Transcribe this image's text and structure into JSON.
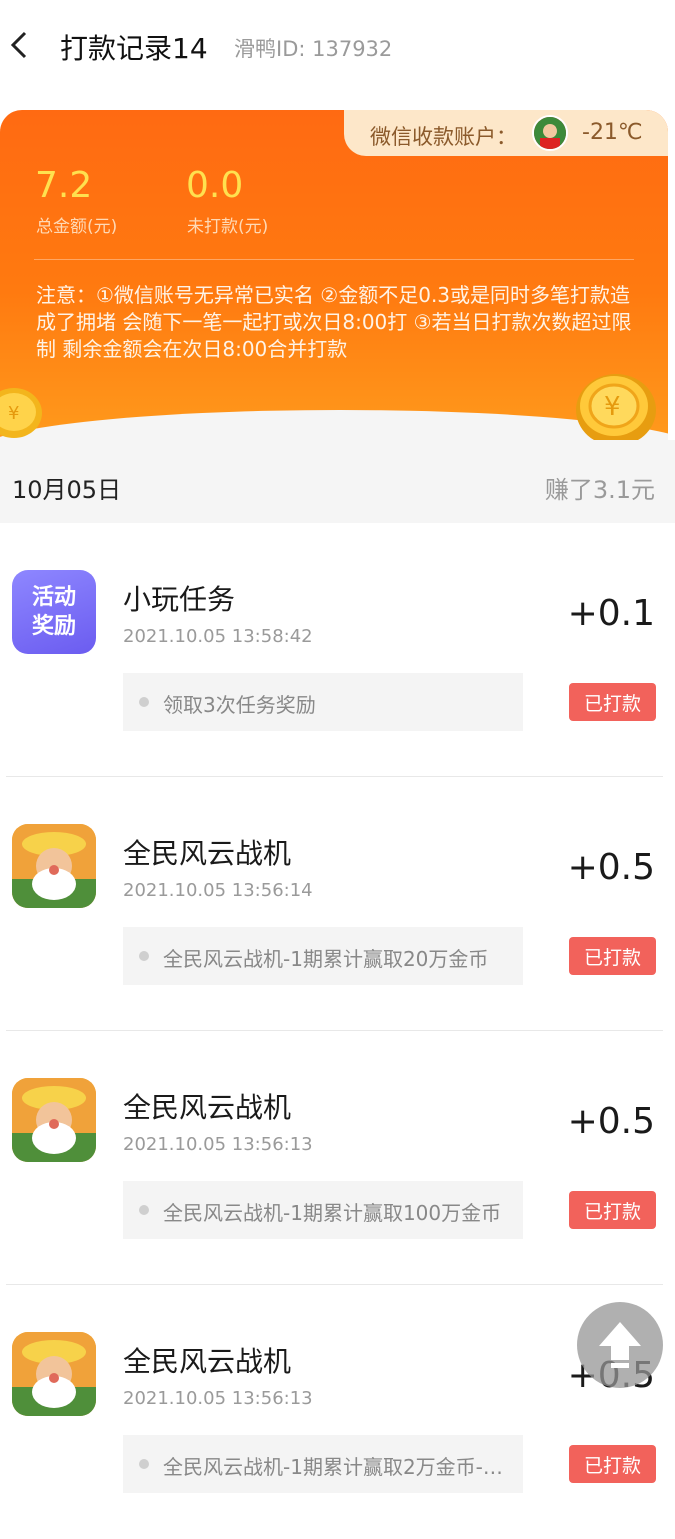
{
  "header": {
    "title": "打款记录14",
    "subtitle": "滑鸭ID: 137932"
  },
  "account": {
    "label": "微信收款账户：",
    "temperature": "-21℃"
  },
  "stats": [
    {
      "value": "7.2",
      "label": "总金额(元)"
    },
    {
      "value": "0.0",
      "label": "未打款(元)"
    }
  ],
  "notice": "注意：①微信账号无异常已实名 ②金额不足0.3或是同时多笔打款造成了拥堵 会随下一笔一起打或次日8:00打 ③若当日打款次数超过限制 剩余金额会在次日8:00合并打款",
  "day": {
    "date": "10月05日",
    "earned": "赚了3.1元"
  },
  "records": [
    {
      "icon_type": "activity",
      "icon_text1": "活动",
      "icon_text2": "奖励",
      "name": "小玩任务",
      "time": "2021.10.05 13:58:42",
      "amount": "+0.1",
      "desc": "领取3次任务奖励",
      "status": "已打款"
    },
    {
      "icon_type": "game",
      "name": "全民风云战机",
      "time": "2021.10.05 13:56:14",
      "amount": "+0.5",
      "desc": "全民风云战机-1期累计赢取20万金币",
      "status": "已打款"
    },
    {
      "icon_type": "game",
      "name": "全民风云战机",
      "time": "2021.10.05 13:56:13",
      "amount": "+0.5",
      "desc": "全民风云战机-1期累计赢取100万金币",
      "status": "已打款"
    },
    {
      "icon_type": "game",
      "name": "全民风云战机",
      "time": "2021.10.05 13:56:13",
      "amount": "+0.5",
      "desc": "全民风云战机-1期累计赢取2万金币-…",
      "status": "已打款"
    }
  ],
  "icons": {
    "back": "back-arrow-icon",
    "scroll_top": "scroll-to-top-icon"
  }
}
